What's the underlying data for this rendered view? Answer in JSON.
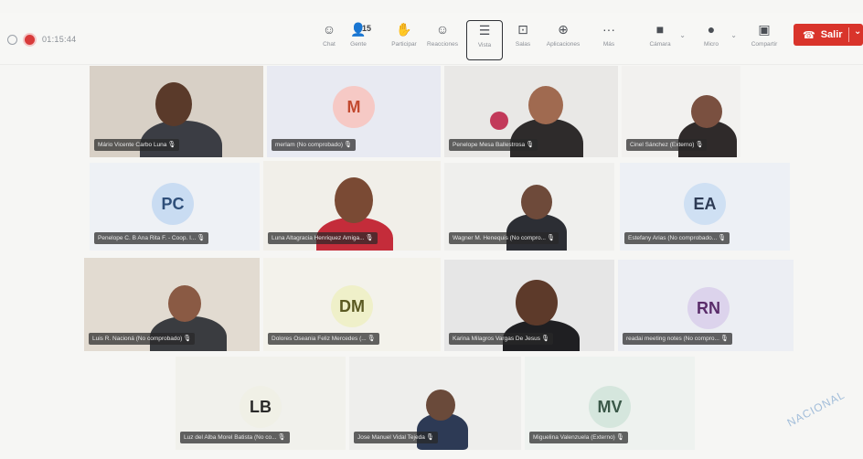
{
  "meeting": {
    "timer": "01:15:44",
    "tools": [
      {
        "icon": "chat-icon",
        "glyph": "☺",
        "label": "Chat"
      },
      {
        "icon": "people-icon",
        "glyph": "👤",
        "label": "Gente",
        "badge": "15"
      },
      {
        "icon": "raise-hand-icon",
        "glyph": "✋",
        "label": "Participar"
      },
      {
        "icon": "reactions-icon",
        "glyph": "☺",
        "label": "Reacciones"
      },
      {
        "icon": "view-icon",
        "glyph": "☰",
        "label": "Vista"
      },
      {
        "icon": "rooms-icon",
        "glyph": "⊡",
        "label": "Salas"
      },
      {
        "icon": "apps-icon",
        "glyph": "⊕",
        "label": "Aplicaciones"
      },
      {
        "icon": "more-icon",
        "glyph": "···",
        "label": "Más"
      },
      {
        "icon": "camera-icon",
        "glyph": "■",
        "label": "Cámara"
      },
      {
        "icon": "mic-icon",
        "glyph": "●",
        "label": "Micro"
      },
      {
        "icon": "share-icon",
        "glyph": "▣",
        "label": "Compartir"
      }
    ],
    "leave_label": "Salir",
    "watermark": "NACIONAL"
  },
  "participants": [
    {
      "name": "Mário Vicente Carbo Luna",
      "type": "video"
    },
    {
      "name": "merlam (No comprobado)",
      "type": "avatar",
      "initials": "M",
      "avatar_bg": "#f6c9c5",
      "avatar_fg": "#c2492f"
    },
    {
      "name": "Penelope Mesa Ballestrosa",
      "type": "video"
    },
    {
      "name": "Cinel Sánchez (Externo)",
      "type": "video"
    },
    {
      "name": "Penelope C. B Ana Rita F. - Coop. I...",
      "type": "avatar",
      "initials": "PC",
      "avatar_bg": "#c9dcf2",
      "avatar_fg": "#2f4f7a"
    },
    {
      "name": "Luna Altagracia Henriquez Amiga...",
      "type": "video"
    },
    {
      "name": "Wagner M. Henequis (No compro...",
      "type": "video"
    },
    {
      "name": "Estefany Arias (No comprobado...",
      "type": "avatar",
      "initials": "EA",
      "avatar_bg": "#cfe0f3",
      "avatar_fg": "#2d3b55"
    },
    {
      "name": "Luis R. Nacioná (No comprobado)",
      "type": "video"
    },
    {
      "name": "Dolores Oseania Feliz Mercedes (...",
      "type": "avatar",
      "initials": "DM",
      "avatar_bg": "#eff0c9",
      "avatar_fg": "#5b5a22"
    },
    {
      "name": "Karina Milagros Vargas De Jesus",
      "type": "video"
    },
    {
      "name": "readai meeting notes (No compro...",
      "type": "avatar",
      "initials": "RN",
      "avatar_bg": "#dcd3ec",
      "avatar_fg": "#5a2c6a"
    },
    {
      "name": "Luz del Alba Morel Batista (No co...",
      "type": "avatar",
      "initials": "LB",
      "avatar_bg": "#f0f0e6",
      "avatar_fg": "#2a2a2a"
    },
    {
      "name": "Jose Manuel Vidal Tejeda",
      "type": "video"
    },
    {
      "name": "Miguelina Valenzuela (Externo)",
      "type": "avatar",
      "initials": "MV",
      "avatar_bg": "#d5e6dd",
      "avatar_fg": "#3a5848"
    }
  ]
}
